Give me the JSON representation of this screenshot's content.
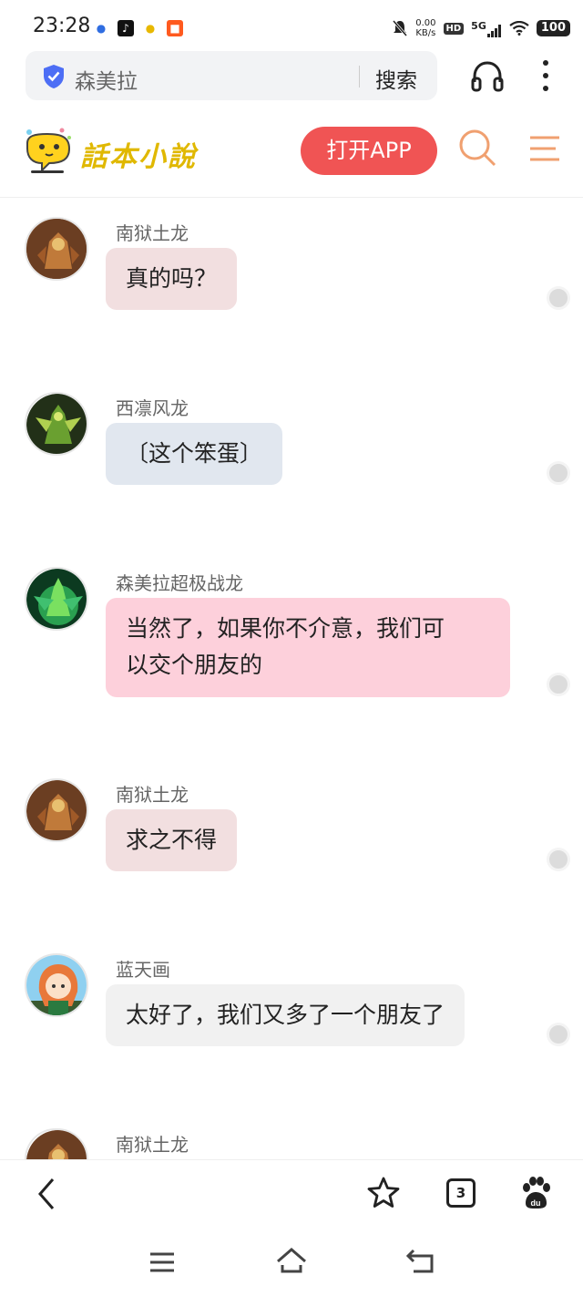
{
  "status": {
    "time": "23:28",
    "net_speed": "0.00",
    "net_unit": "KB/s",
    "hd": "HD",
    "signal": "5G",
    "battery": "100"
  },
  "browser": {
    "search_text": "森美拉",
    "search_button": "搜索"
  },
  "site": {
    "logo_text": "話本小說",
    "open_app": "打开APP"
  },
  "messages": [
    {
      "sender": "南狱土龙",
      "text": "真的吗？",
      "bubble_color": "#f2dfe0"
    },
    {
      "sender": "西凛风龙",
      "text": "〔这个笨蛋〕",
      "bubble_color": "#e1e7ef"
    },
    {
      "sender": "森美拉超极战龙",
      "text_line1": "当然了，如果你不介意，我们可",
      "text_line2": "以交个朋友的",
      "bubble_color": "#fdd0db"
    },
    {
      "sender": "南狱土龙",
      "text": "求之不得",
      "bubble_color": "#f2dfe0"
    },
    {
      "sender": "蓝天画",
      "text": "太好了，我们又多了一个朋友了",
      "bubble_color": "#f1f1f1"
    },
    {
      "sender": "南狱土龙"
    }
  ],
  "toolbar": {
    "tab_count": "3"
  },
  "icons": {
    "shield": "shield-check-icon",
    "headphone": "headphone-icon",
    "search": "search-icon",
    "menu": "hamburger-menu-icon",
    "back": "chevron-left-icon",
    "star": "star-icon",
    "tabs": "tabs-icon",
    "baidu": "baidu-paw-icon"
  },
  "colors": {
    "accent_red": "#f05454",
    "search_orange": "#f0a070"
  }
}
